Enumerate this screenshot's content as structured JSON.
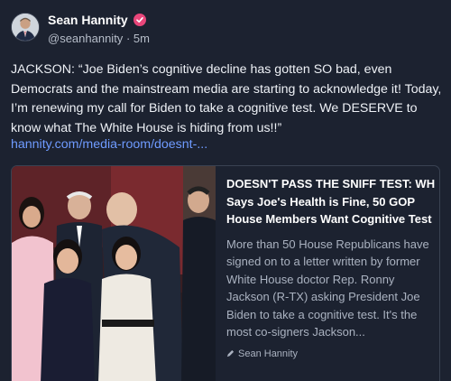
{
  "user": {
    "display_name": "Sean Hannity",
    "handle": "@seanhannity",
    "separator": "·",
    "time": "5m"
  },
  "post": {
    "text": "JACKSON: “Joe Biden’s cognitive decline has gotten SO bad, even Democrats and the mainstream media are starting to acknowledge it! Today, I’m renewing my call for Biden to take a cognitive test. We DESERVE to know what The White House is hiding from us!!”",
    "link": "hannity.com/media-room/doesnt-..."
  },
  "card": {
    "title": "DOESN'T PASS THE SNIFF TEST: WH Says Joe's Health is Fine, 50 GOP House Members Want Cognitive Test",
    "description": "More than 50 House Republicans have signed on to a letter written by former White House doctor Rep. Ronny Jackson (R-TX) asking President Joe Biden to take a cognitive test. It's the most co-signers Jackson...",
    "author": "Sean Hannity"
  },
  "icons": {
    "verified": "verified-badge-icon",
    "avatar": "avatar-image",
    "author": "pen-icon"
  },
  "colors": {
    "background": "#1c2230",
    "link": "#6f9bff",
    "verified_badge": "#e8467a",
    "muted_text": "#aab2c0"
  }
}
